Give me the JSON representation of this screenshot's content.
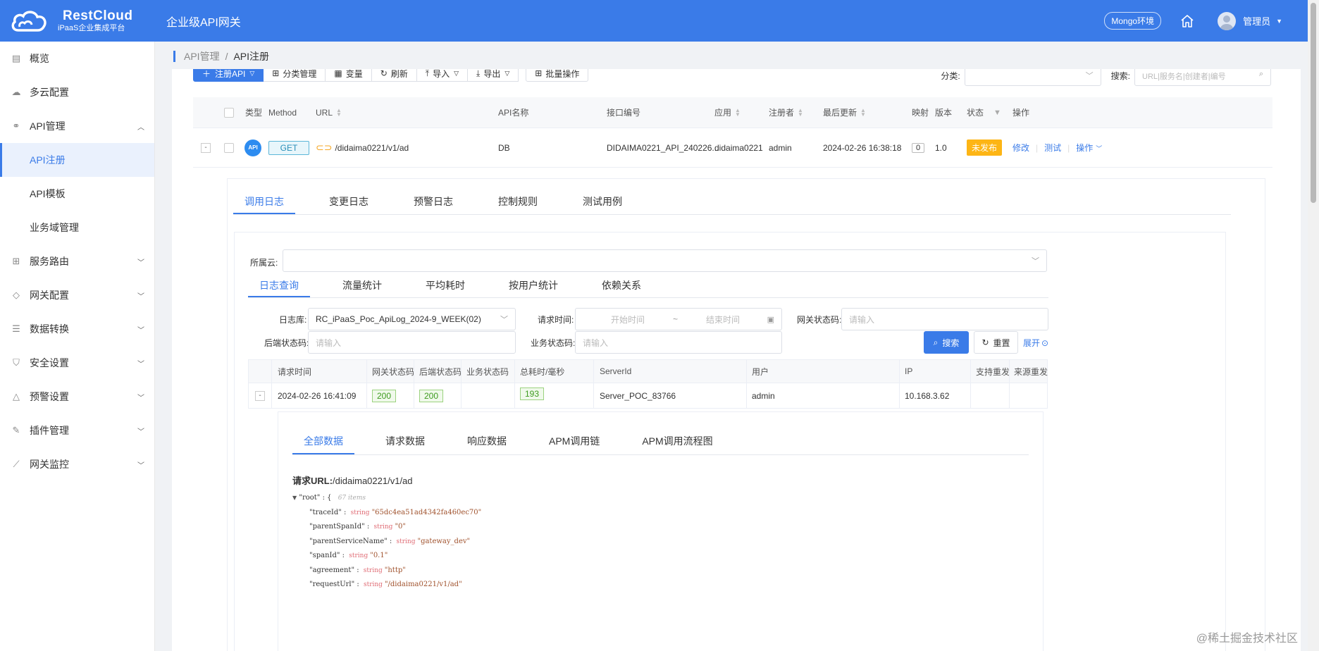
{
  "header": {
    "brand_name": "RestCloud",
    "brand_sub": "iPaaS企业集成平台",
    "title": "企业级API网关",
    "env_badge": "Mongo环境",
    "user_name": "管理员"
  },
  "sidebar": {
    "items": [
      {
        "label": "概览",
        "icon": "dashboard-icon"
      },
      {
        "label": "多云配置",
        "icon": "cloud-icon"
      },
      {
        "label": "API管理",
        "icon": "link-icon",
        "expanded": true
      },
      {
        "label": "API注册",
        "active": true
      },
      {
        "label": "API模板"
      },
      {
        "label": "业务域管理"
      },
      {
        "label": "服务路由",
        "icon": "grid-icon"
      },
      {
        "label": "网关配置",
        "icon": "tag-icon"
      },
      {
        "label": "数据转换",
        "icon": "database-icon"
      },
      {
        "label": "安全设置",
        "icon": "shield-icon"
      },
      {
        "label": "预警设置",
        "icon": "warning-icon"
      },
      {
        "label": "插件管理",
        "icon": "edit-icon"
      },
      {
        "label": "网关监控",
        "icon": "chart-icon"
      }
    ]
  },
  "breadcrumb": {
    "parent": "API管理",
    "sep": "/",
    "current": "API注册"
  },
  "toolbar": {
    "register": "注册API",
    "category_manage": "分类管理",
    "variables": "变量",
    "refresh": "刷新",
    "import": "导入",
    "export": "导出",
    "batch": "批量操作",
    "category_label": "分类:",
    "search_label": "搜索:",
    "search_placeholder": "URL|服务名|创建者|编号"
  },
  "api_table": {
    "headers": {
      "type": "类型",
      "method": "Method",
      "url": "URL",
      "name": "API名称",
      "code": "接口编号",
      "app": "应用",
      "creator": "注册者",
      "updated": "最后更新",
      "mapping": "映射",
      "version": "版本",
      "status": "状态",
      "ops": "操作"
    },
    "row": {
      "expand": "-",
      "type_icon": "API",
      "method": "GET",
      "url": "/didaima0221/v1/ad",
      "name": "DB",
      "code": "DIDAIMA0221_API_240226...",
      "app": "didaima0221",
      "creator": "admin",
      "updated": "2024-02-26 16:38:18",
      "mapping": "0",
      "version": "1.0",
      "status": "未发布",
      "op_edit": "修改",
      "op_test": "测试",
      "op_more": "操作"
    }
  },
  "detail_tabs": [
    "调用日志",
    "变更日志",
    "预警日志",
    "控制规则",
    "测试用例"
  ],
  "log_panel": {
    "cloud_label": "所属云:",
    "sub_tabs": [
      "日志查询",
      "流量统计",
      "平均耗时",
      "按用户统计",
      "依赖关系"
    ],
    "log_db_label": "日志库:",
    "log_db_value": "RC_iPaaS_Poc_ApiLog_2024-9_WEEK(02)",
    "req_time_label": "请求时间:",
    "start_placeholder": "开始时间",
    "range_sep": "~",
    "end_placeholder": "结束时间",
    "gw_status_label": "网关状态码:",
    "gw_status_placeholder": "请输入",
    "backend_status_label": "后端状态码:",
    "backend_status_placeholder": "请输入",
    "biz_status_label": "业务状态码:",
    "biz_status_placeholder": "请输入",
    "search_btn": "搜索",
    "reset_btn": "重置",
    "expand_link": "展开"
  },
  "log_table": {
    "headers": [
      "请求时间",
      "网关状态码",
      "后端状态码",
      "业务状态码",
      "总耗时/毫秒",
      "ServerId",
      "用户",
      "IP",
      "支持重发",
      "来源重发"
    ],
    "row": {
      "expand": "-",
      "time": "2024-02-26 16:41:09",
      "gw_status": "200",
      "backend_status": "200",
      "biz_status": "",
      "cost": "193",
      "server_id": "Server_POC_83766",
      "user": "admin",
      "ip": "10.168.3.62"
    }
  },
  "data_tabs": [
    "全部数据",
    "请求数据",
    "响应数据",
    "APM调用链",
    "APM调用流程图"
  ],
  "request_url": {
    "label": "请求URL:",
    "value": "/didaima0221/v1/ad"
  },
  "json_tree": {
    "root_key": "\"root\"",
    "root_brace": ": {",
    "root_count": "67 items",
    "type_label": "string",
    "entries": [
      {
        "key": "\"traceId\"",
        "value": "\"65dc4ea51ad4342fa460ec70\""
      },
      {
        "key": "\"parentSpanId\"",
        "value": "\"0\""
      },
      {
        "key": "\"parentServiceName\"",
        "value": "\"gateway_dev\""
      },
      {
        "key": "\"spanId\"",
        "value": "\"0.1\""
      },
      {
        "key": "\"agreement\"",
        "value": "\"http\""
      },
      {
        "key": "\"requestUrl\"",
        "value": "\"/didaima0221/v1/ad\""
      }
    ]
  },
  "watermark": "@稀土掘金技术社区"
}
